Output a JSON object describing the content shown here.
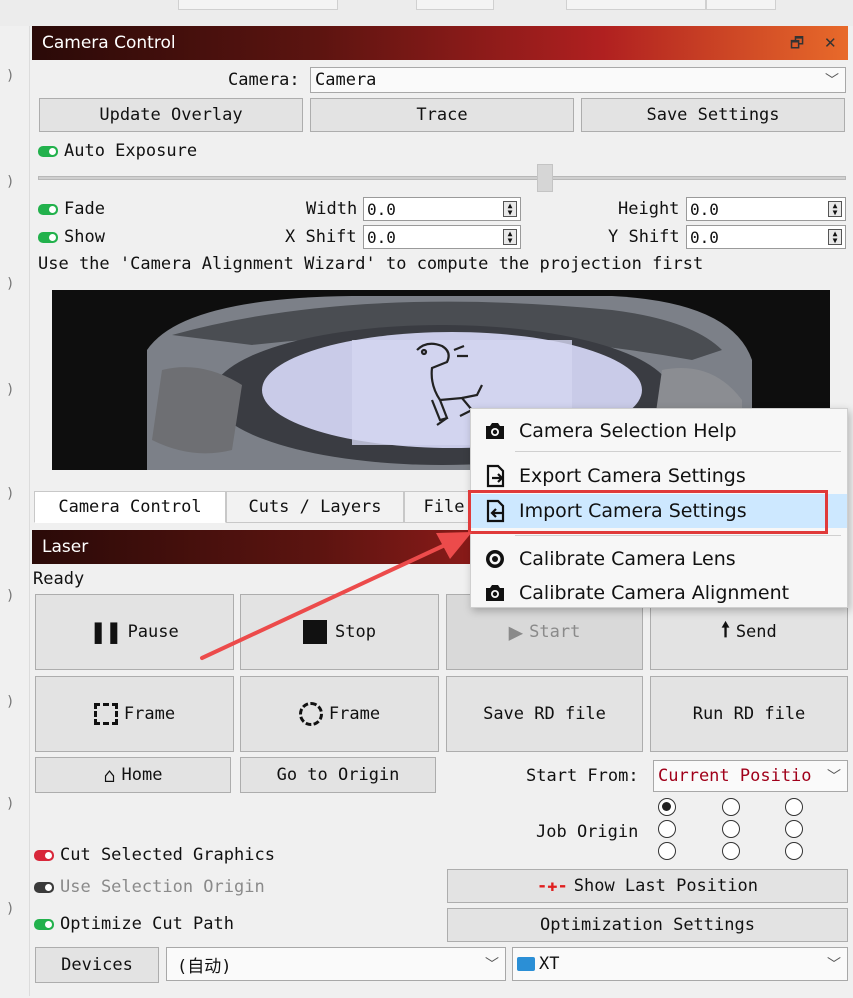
{
  "camera_panel": {
    "title": "Camera Control",
    "camera_label": "Camera:",
    "camera_value": "Camera",
    "update_overlay": "Update Overlay",
    "trace": "Trace",
    "save_settings": "Save Settings",
    "auto_exposure": "Auto Exposure",
    "exposure_level": 0.63,
    "fade": "Fade",
    "show": "Show",
    "width_label": "Width",
    "width_value": "0.0",
    "height_label": "Height",
    "height_value": "0.0",
    "xshift_label": "X Shift",
    "xshift_value": "0.0",
    "yshift_label": "Y Shift",
    "yshift_value": "0.0",
    "hint": "Use the 'Camera Alignment Wizard' to compute the projection first"
  },
  "tabs": [
    "Camera Control",
    "Cuts / Layers",
    "File"
  ],
  "context_menu": {
    "items": [
      {
        "label": "Camera Selection Help",
        "icon": "camera-icon"
      },
      {
        "label": "Export Camera Settings",
        "icon": "export-icon"
      },
      {
        "label": "Import Camera Settings",
        "icon": "import-icon"
      },
      {
        "label": "Calibrate Camera Lens",
        "icon": "lens-icon"
      },
      {
        "label": "Calibrate Camera Alignment",
        "icon": "camera-icon"
      }
    ]
  },
  "laser_panel": {
    "title": "Laser",
    "status": "Ready",
    "pause": "Pause",
    "stop": "Stop",
    "start": "Start",
    "send": "Send",
    "frame1": "Frame",
    "frame2": "Frame",
    "save_rd": "Save RD file",
    "run_rd": "Run RD file",
    "home": "Home",
    "go_origin": "Go to Origin",
    "start_from_label": "Start From:",
    "start_from_value": "Current Positio",
    "job_origin_label": "Job Origin",
    "cut_selected": "Cut Selected Graphics",
    "use_selection_origin": "Use Selection Origin",
    "optimize_cut": "Optimize Cut Path",
    "show_last_position": "Show Last Position",
    "optimization_settings": "Optimization Settings",
    "devices": "Devices",
    "device_value": "(自动)",
    "device_name": "XT"
  },
  "colors": {
    "led_green": "#22b14c",
    "led_red": "#d8273a",
    "led_dark": "#3a3a3a",
    "highlight": "#cde8ff",
    "annotation_red": "#e03a3a",
    "start_from_text": "#a0001a"
  }
}
